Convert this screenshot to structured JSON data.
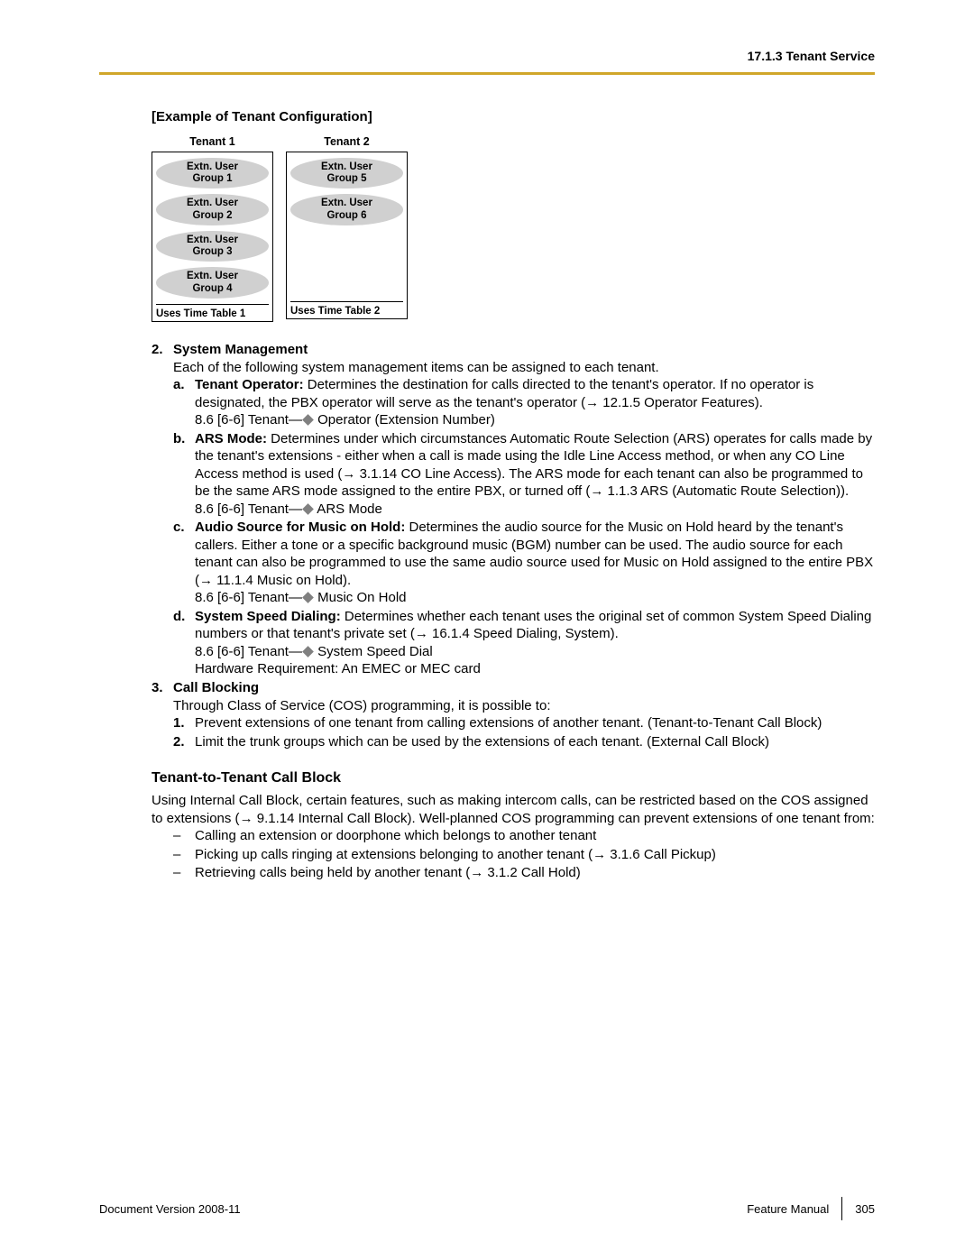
{
  "header": {
    "right": "17.1.3 Tenant Service"
  },
  "example_heading": "[Example of Tenant Configuration]",
  "diagram": {
    "tenant1_label": "Tenant 1",
    "tenant2_label": "Tenant 2",
    "t1_g1a": "Extn. User",
    "t1_g1b": "Group 1",
    "t1_g2a": "Extn. User",
    "t1_g2b": "Group 2",
    "t1_g3a": "Extn. User",
    "t1_g3b": "Group 3",
    "t1_g4a": "Extn. User",
    "t1_g4b": "Group 4",
    "t2_g1a": "Extn. User",
    "t2_g1b": "Group 5",
    "t2_g2a": "Extn. User",
    "t2_g2b": "Group 6",
    "t1_uses": "Uses Time Table 1",
    "t2_uses": "Uses Time Table 2"
  },
  "sec2": {
    "num": "2.",
    "title": "System Management",
    "intro": "Each of the following system management items can be assigned to each tenant.",
    "a": {
      "letter": "a.",
      "bold": "Tenant Operator:",
      "t1": " Determines the destination for calls directed to the tenant's operator. If no operator is designated, the PBX operator will serve as the tenant's operator (",
      "ref": "→ 12.1.5  Operator Features",
      "t2": ").",
      "line2a": "8.6  [6-6] Tenant—",
      "line2b": " Operator (Extension Number)"
    },
    "b": {
      "letter": "b.",
      "bold": "ARS Mode:",
      "t1": " Determines under which circumstances Automatic Route Selection (ARS) operates for calls made by the tenant's extensions - either when a call is made using the Idle Line Access method, or when any CO Line Access method is used (",
      "ref1": "→ 3.1.14  CO Line Access",
      "t2": "). The ARS mode for each tenant can also be programmed to be the same ARS mode assigned to the entire PBX, or turned off (",
      "ref2": "→ 1.1.3  ARS (Automatic Route Selection)",
      "t3": ").",
      "line2a": "8.6  [6-6] Tenant—",
      "line2b": " ARS Mode"
    },
    "c": {
      "letter": "c.",
      "bold": "Audio Source for Music on Hold:",
      "t1": " Determines the audio source for the Music on Hold heard by the tenant's callers. Either a tone or a specific background music (BGM) number can be used. The audio source for each tenant can also be programmed to use the same audio source used for Music on Hold assigned to the entire PBX (",
      "ref": "→ 11.1.4  Music on Hold",
      "t2": ").",
      "line2a": "8.6  [6-6] Tenant—",
      "line2b": " Music On Hold"
    },
    "d": {
      "letter": "d.",
      "bold": "System Speed Dialing:",
      "t1": " Determines whether each tenant uses the original set of common System Speed Dialing numbers or that tenant's private set (",
      "ref": "→ 16.1.4  Speed Dialing, System",
      "t2": ").",
      "line2a": "8.6  [6-6] Tenant—",
      "line2b": " System Speed Dial",
      "line3": "Hardware Requirement: An EMEC or MEC card"
    }
  },
  "sec3": {
    "num": "3.",
    "title": "Call Blocking",
    "intro": "Through Class of Service (COS) programming, it is possible to:",
    "i1": {
      "letter": "1.",
      "text": "Prevent extensions of one tenant from calling extensions of another tenant. (Tenant-to-Tenant Call Block)"
    },
    "i2": {
      "letter": "2.",
      "text": "Limit the trunk groups which can be used by the extensions of each tenant. (External Call Block)"
    }
  },
  "callblock": {
    "heading": "Tenant-to-Tenant Call Block",
    "p1a": "Using Internal Call Block, certain features, such as making intercom calls, can be restricted based on the COS assigned to extensions (",
    "p1ref": "→ 9.1.14  Internal Call Block",
    "p1b": "). Well-planned COS programming can prevent extensions of one tenant from:",
    "b1": "Calling an extension or doorphone which belongs to another tenant",
    "b2a": "Picking up calls ringing at extensions belonging to another tenant (",
    "b2ref": "→ 3.1.6  Call Pickup",
    "b2b": ")",
    "b3a": "Retrieving calls being held by another tenant (",
    "b3ref": "→ 3.1.2  Call Hold",
    "b3b": ")"
  },
  "footer": {
    "left": "Document Version  2008-11",
    "right_label": "Feature Manual",
    "page": "305"
  }
}
